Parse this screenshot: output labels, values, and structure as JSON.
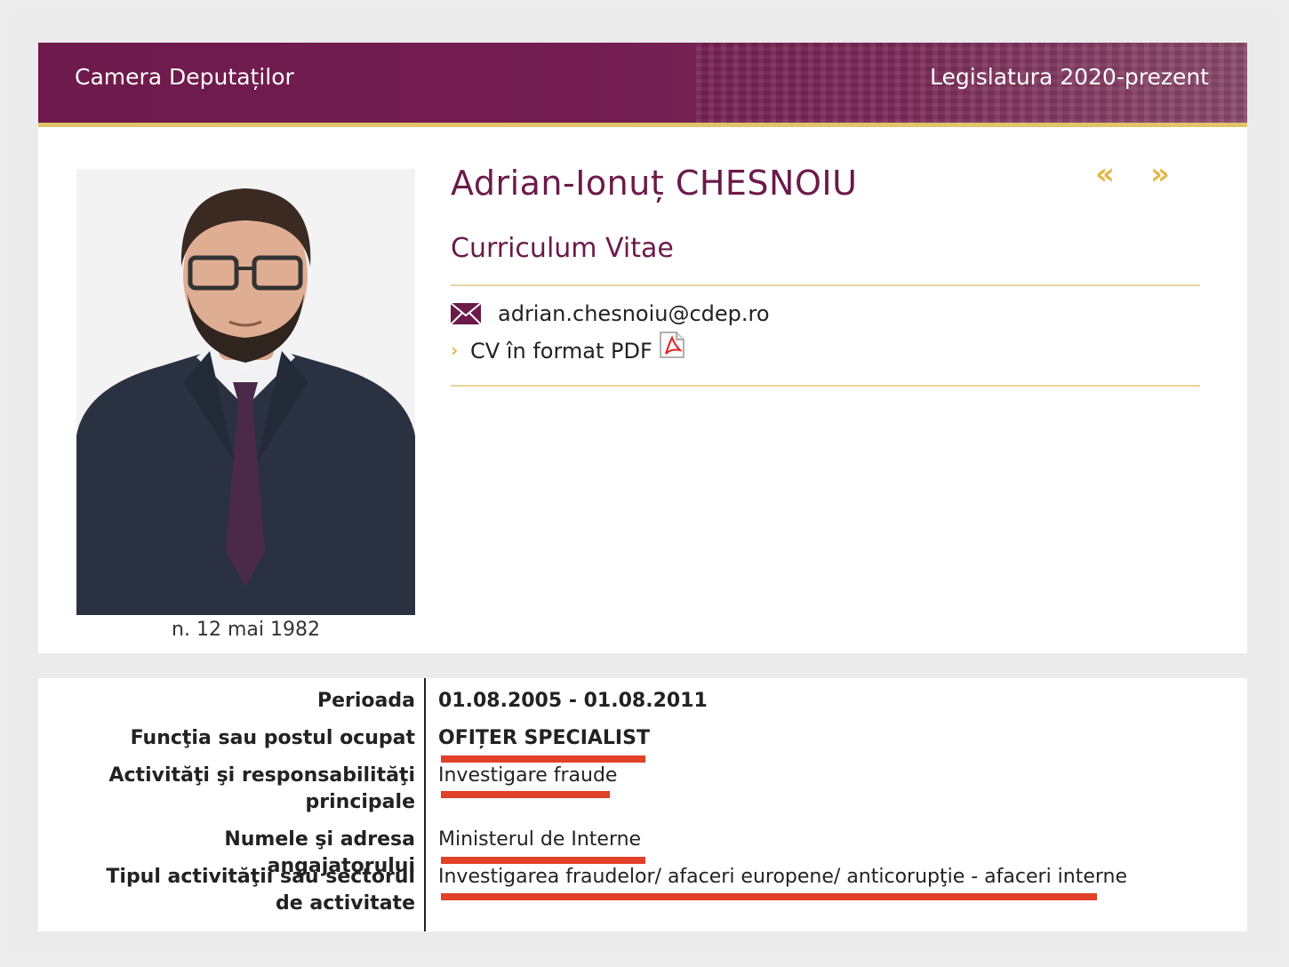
{
  "header": {
    "site_title": "Camera Deputaților",
    "legislature": "Legislatura 2020-prezent"
  },
  "profile": {
    "name": "Adrian-Ionuț CHESNOIU",
    "subtitle": "Curriculum Vitae",
    "birth": "n. 12 mai 1982",
    "email": "adrian.chesnoiu@cdep.ro",
    "cv_pdf_label": "CV în format PDF",
    "nav_prev": "«",
    "nav_next": "»",
    "cv_arrow": "›"
  },
  "details": [
    {
      "label": "Perioada",
      "value": "01.08.2005 - 01.08.2011"
    },
    {
      "label": "Funcţia sau postul ocupat",
      "value": "OFIȚER SPECIALIST"
    },
    {
      "label": "Activităţi şi responsabilităţi principale",
      "value": "Investigare fraude"
    },
    {
      "label": "Numele şi adresa angajatorului",
      "value": "Ministerul de Interne"
    },
    {
      "label": "Tipul activităţii sau sectorul de activitate",
      "value": "Investigarea fraudelor/ afaceri europene/ anticorupţie - afaceri interne"
    }
  ],
  "colors": {
    "brand": "#6e1a4c",
    "accent_gold": "#e0c46a",
    "highlight_red": "#e04128"
  },
  "icons": [
    "envelope-icon",
    "pdf-icon",
    "prev-icon",
    "next-icon"
  ]
}
